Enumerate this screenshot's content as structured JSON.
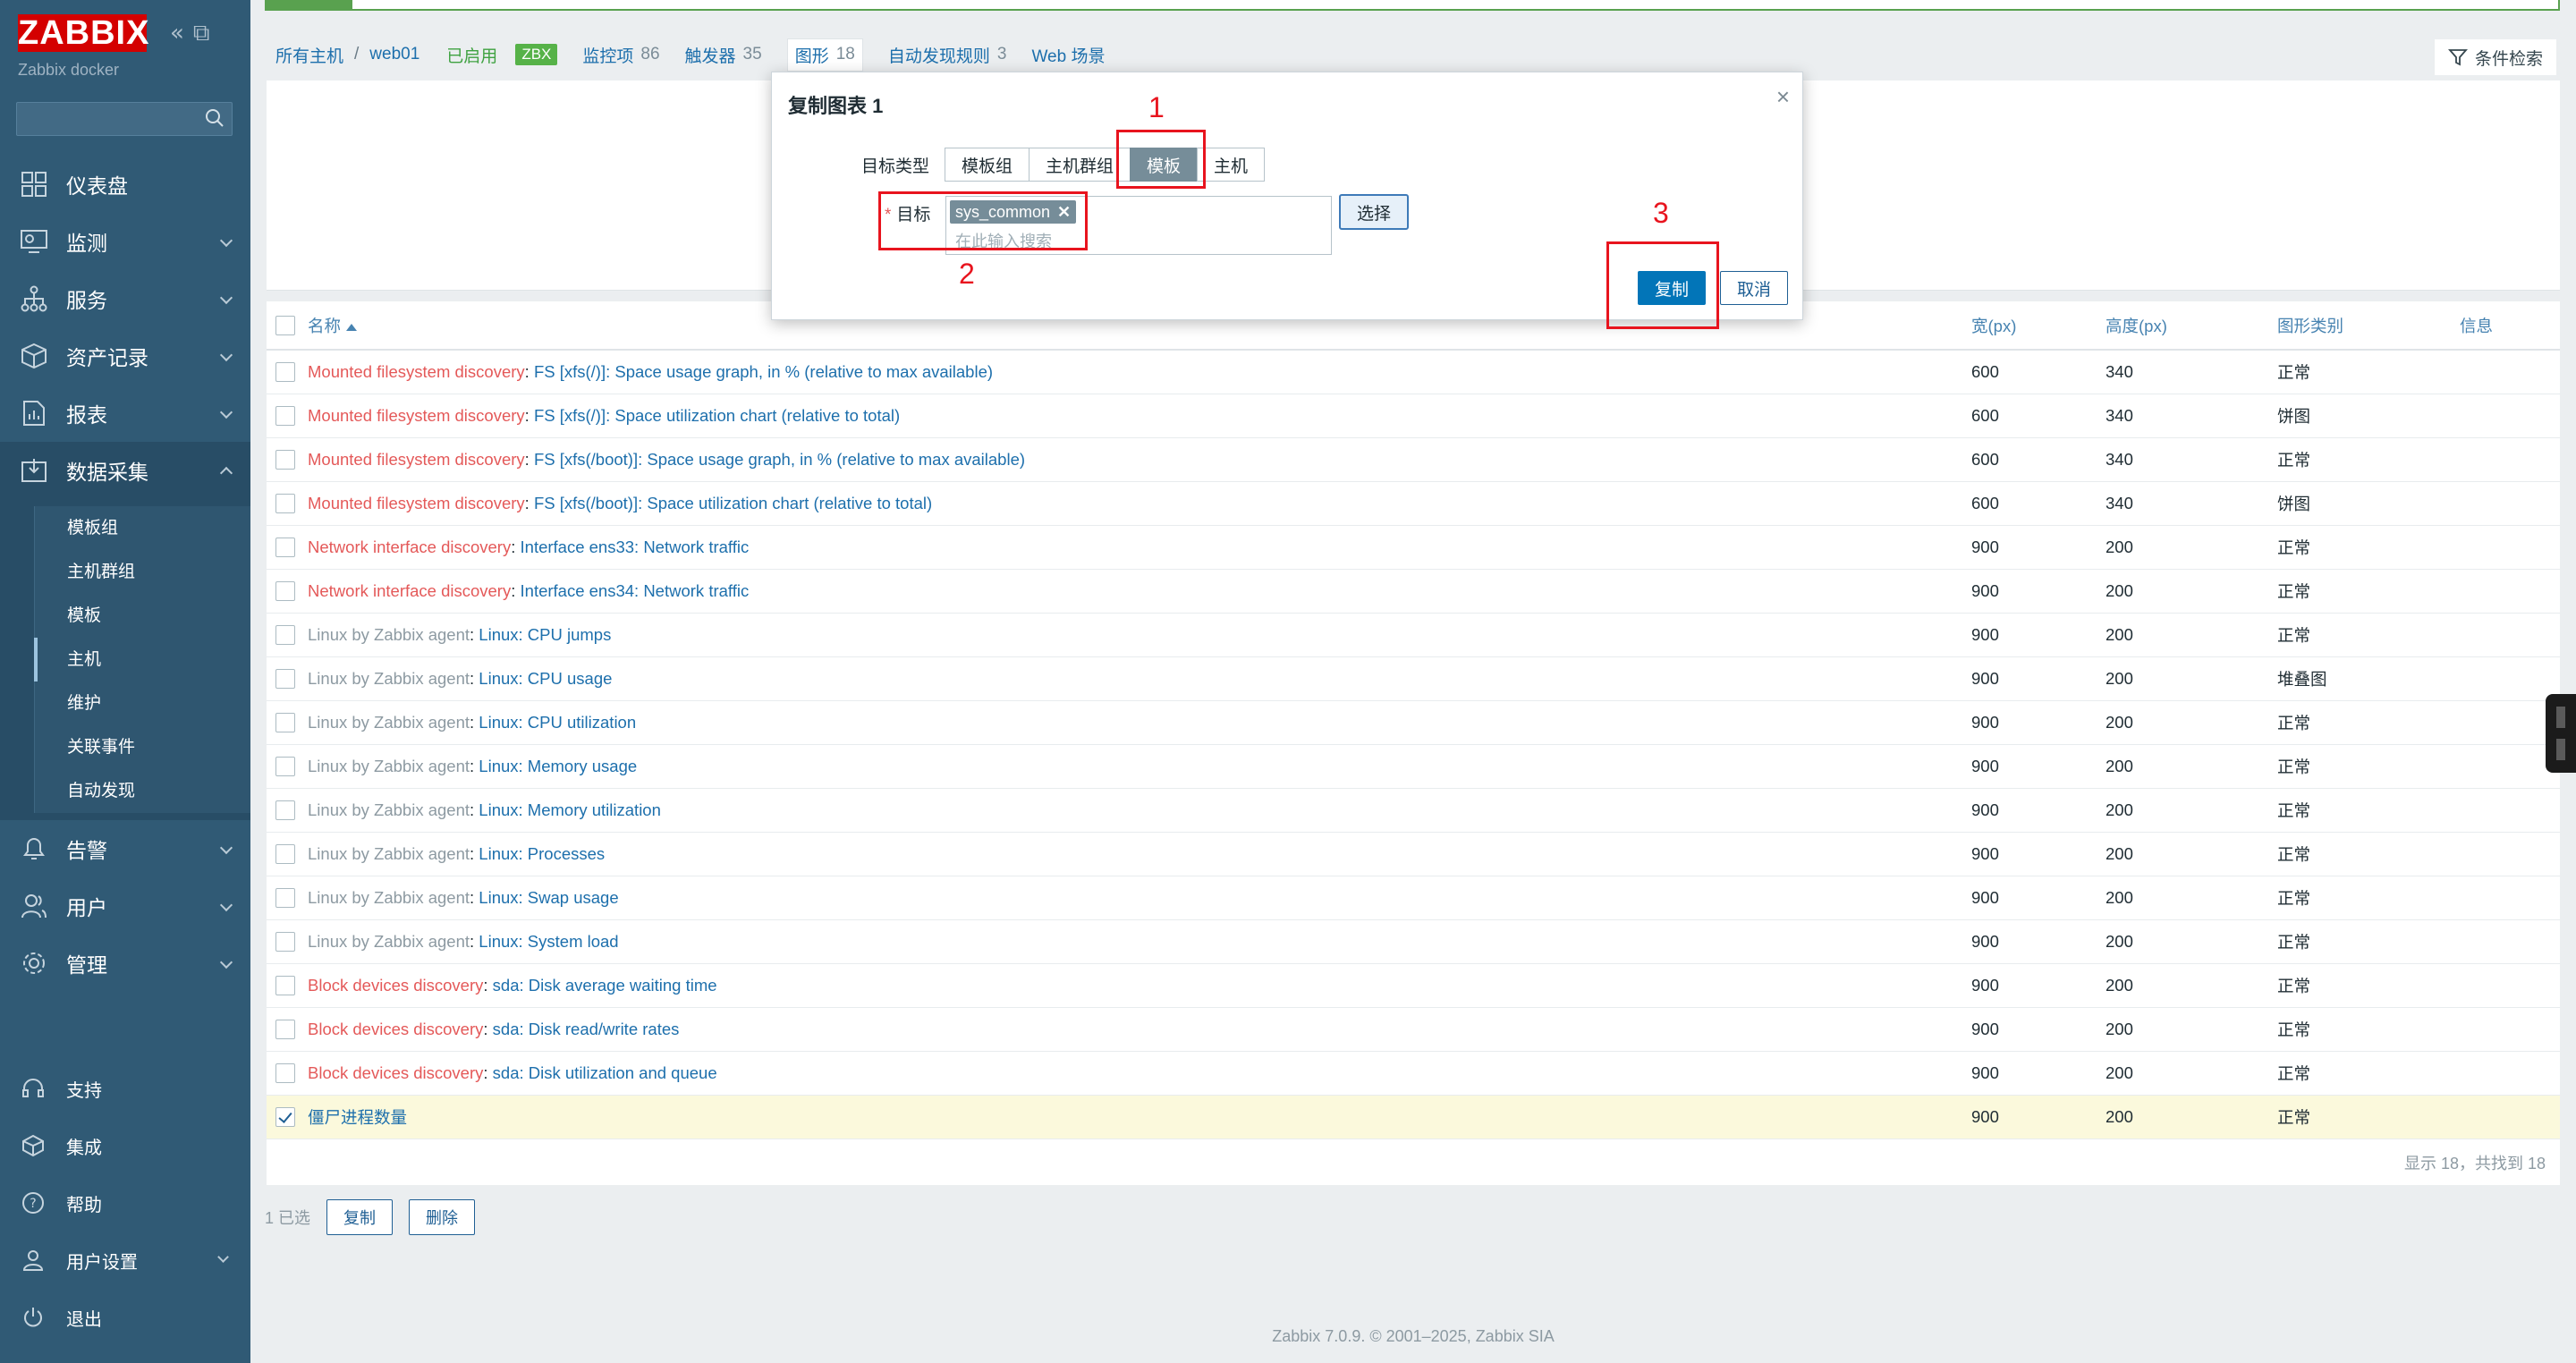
{
  "app": {
    "logo": "ZABBIX",
    "subtitle": "Zabbix docker"
  },
  "sidebar": {
    "main_items": [
      {
        "label": "仪表盘",
        "icon": "dashboard-icon"
      },
      {
        "label": "监测",
        "icon": "monitoring-icon"
      },
      {
        "label": "服务",
        "icon": "services-icon"
      },
      {
        "label": "资产记录",
        "icon": "inventory-icon"
      },
      {
        "label": "报表",
        "icon": "reports-icon"
      },
      {
        "label": "数据采集",
        "icon": "data-collection-icon"
      }
    ],
    "submenu": [
      "模板组",
      "主机群组",
      "模板",
      "主机",
      "维护",
      "关联事件",
      "自动发现"
    ],
    "after_items": [
      {
        "label": "告警",
        "icon": "alerts-icon"
      },
      {
        "label": "用户",
        "icon": "users-icon"
      },
      {
        "label": "管理",
        "icon": "administration-icon"
      }
    ],
    "bottom_items": [
      {
        "label": "支持",
        "icon": "support-icon"
      },
      {
        "label": "集成",
        "icon": "integrations-icon"
      },
      {
        "label": "帮助",
        "icon": "help-icon"
      },
      {
        "label": "用户设置",
        "icon": "user-settings-icon"
      },
      {
        "label": "退出",
        "icon": "signout-icon"
      }
    ]
  },
  "breadcrumb": {
    "all_hosts": "所有主机",
    "separator": "/",
    "host": "web01",
    "enabled": "已启用",
    "zbx": "ZBX",
    "tabs": [
      {
        "label": "监控项",
        "count": "86"
      },
      {
        "label": "触发器",
        "count": "35"
      },
      {
        "label": "图形",
        "count": "18"
      },
      {
        "label": "自动发现规则",
        "count": "3"
      },
      {
        "label": "Web 场景",
        "count": ""
      }
    ]
  },
  "filter": {
    "label": "条件检索"
  },
  "table": {
    "headers": {
      "name": "名称",
      "width": "宽(px)",
      "height": "高度(px)",
      "type": "图形类别",
      "info": "信息"
    },
    "rows": [
      {
        "prefix": "Mounted filesystem discovery",
        "pfx": "red",
        "name": "FS [xfs(/)]: Space usage graph, in % (relative to max available)",
        "w": "600",
        "h": "340",
        "t": "正常",
        "checked": false
      },
      {
        "prefix": "Mounted filesystem discovery",
        "pfx": "red",
        "name": "FS [xfs(/)]: Space utilization chart (relative to total)",
        "w": "600",
        "h": "340",
        "t": "饼图",
        "checked": false
      },
      {
        "prefix": "Mounted filesystem discovery",
        "pfx": "red",
        "name": "FS [xfs(/boot)]: Space usage graph, in % (relative to max available)",
        "w": "600",
        "h": "340",
        "t": "正常",
        "checked": false
      },
      {
        "prefix": "Mounted filesystem discovery",
        "pfx": "red",
        "name": "FS [xfs(/boot)]: Space utilization chart (relative to total)",
        "w": "600",
        "h": "340",
        "t": "饼图",
        "checked": false
      },
      {
        "prefix": "Network interface discovery",
        "pfx": "red",
        "name": "Interface ens33: Network traffic",
        "w": "900",
        "h": "200",
        "t": "正常",
        "checked": false
      },
      {
        "prefix": "Network interface discovery",
        "pfx": "red",
        "name": "Interface ens34: Network traffic",
        "w": "900",
        "h": "200",
        "t": "正常",
        "checked": false
      },
      {
        "prefix": "Linux by Zabbix agent",
        "pfx": "gray",
        "name": "Linux: CPU jumps",
        "w": "900",
        "h": "200",
        "t": "正常",
        "checked": false
      },
      {
        "prefix": "Linux by Zabbix agent",
        "pfx": "gray",
        "name": "Linux: CPU usage",
        "w": "900",
        "h": "200",
        "t": "堆叠图",
        "checked": false
      },
      {
        "prefix": "Linux by Zabbix agent",
        "pfx": "gray",
        "name": "Linux: CPU utilization",
        "w": "900",
        "h": "200",
        "t": "正常",
        "checked": false
      },
      {
        "prefix": "Linux by Zabbix agent",
        "pfx": "gray",
        "name": "Linux: Memory usage",
        "w": "900",
        "h": "200",
        "t": "正常",
        "checked": false
      },
      {
        "prefix": "Linux by Zabbix agent",
        "pfx": "gray",
        "name": "Linux: Memory utilization",
        "w": "900",
        "h": "200",
        "t": "正常",
        "checked": false
      },
      {
        "prefix": "Linux by Zabbix agent",
        "pfx": "gray",
        "name": "Linux: Processes",
        "w": "900",
        "h": "200",
        "t": "正常",
        "checked": false
      },
      {
        "prefix": "Linux by Zabbix agent",
        "pfx": "gray",
        "name": "Linux: Swap usage",
        "w": "900",
        "h": "200",
        "t": "正常",
        "checked": false
      },
      {
        "prefix": "Linux by Zabbix agent",
        "pfx": "gray",
        "name": "Linux: System load",
        "w": "900",
        "h": "200",
        "t": "正常",
        "checked": false
      },
      {
        "prefix": "Block devices discovery",
        "pfx": "red",
        "name": "sda: Disk average waiting time",
        "w": "900",
        "h": "200",
        "t": "正常",
        "checked": false
      },
      {
        "prefix": "Block devices discovery",
        "pfx": "red",
        "name": "sda: Disk read/write rates",
        "w": "900",
        "h": "200",
        "t": "正常",
        "checked": false
      },
      {
        "prefix": "Block devices discovery",
        "pfx": "red",
        "name": "sda: Disk utilization and queue",
        "w": "900",
        "h": "200",
        "t": "正常",
        "checked": false
      },
      {
        "prefix": "",
        "pfx": "",
        "name": "僵尸进程数量",
        "w": "900",
        "h": "200",
        "t": "正常",
        "checked": true
      }
    ],
    "footer": "显示 18，共找到 18"
  },
  "actions": {
    "selected": "1 已选",
    "copy": "复制",
    "delete": "删除"
  },
  "copyright": "Zabbix 7.0.9. © 2001–2025, Zabbix SIA",
  "dialog": {
    "title": "复制图表 1",
    "target_type_label": "目标类型",
    "target_types": [
      "模板组",
      "主机群组",
      "模板",
      "主机"
    ],
    "active_type": "模板",
    "target_label": "目标",
    "chip": "sys_common",
    "placeholder": "在此输入搜索",
    "select_btn": "选择",
    "copy_btn": "复制",
    "cancel_btn": "取消"
  },
  "annotations": [
    "1",
    "2",
    "3"
  ],
  "colors": {
    "sidebar": "#305a75",
    "accent": "#0275b8",
    "annotation": "#e8141e",
    "logo": "#d40000"
  }
}
